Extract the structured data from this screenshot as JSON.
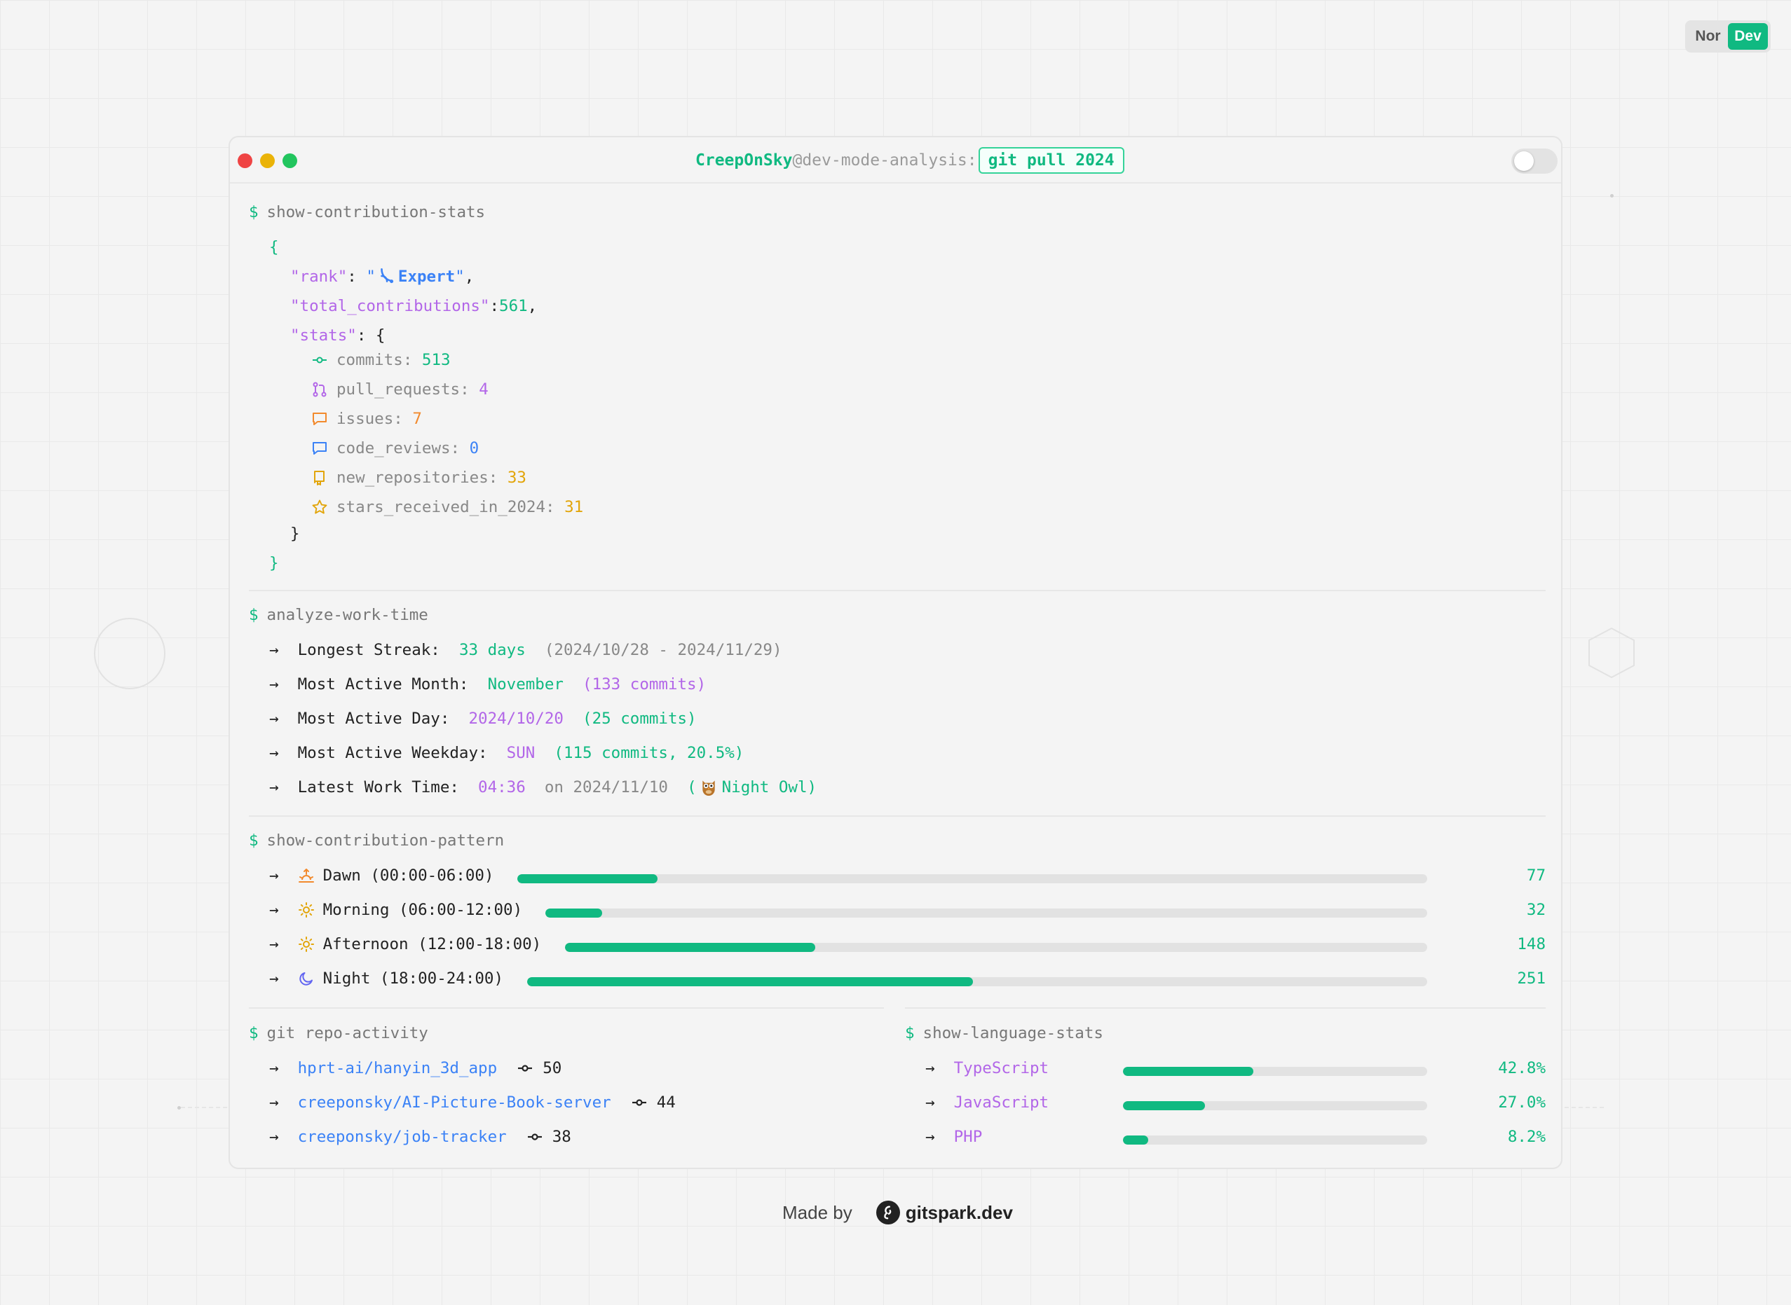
{
  "mode_toggle": {
    "options": [
      "Nor",
      "Dev"
    ],
    "active": "Dev"
  },
  "titlebar": {
    "user": "CreepOnSky",
    "host": "@dev-mode-analysis:",
    "branch": "git pull 2024"
  },
  "contribution_stats": {
    "command": "show-contribution-stats",
    "open_brace": "{",
    "close_brace": "}",
    "rank_key": "\"rank\"",
    "rank_value": "Expert",
    "total_key": "\"total_contributions\"",
    "total_value": "561",
    "stats_key": "\"stats\"",
    "stats": [
      {
        "key": "commits:",
        "value": "513",
        "icon": "commit-icon"
      },
      {
        "key": "pull_requests:",
        "value": "4",
        "icon": "pull-request-icon"
      },
      {
        "key": "issues:",
        "value": "7",
        "icon": "issue-icon"
      },
      {
        "key": "code_reviews:",
        "value": "0",
        "icon": "review-icon"
      },
      {
        "key": "new_repositories:",
        "value": "33",
        "icon": "repository-icon"
      },
      {
        "key": "stars_received_in_2024:",
        "value": "31",
        "icon": "star-icon"
      }
    ]
  },
  "work_time": {
    "command": "analyze-work-time",
    "arrow": "→",
    "longest_streak": {
      "label": "Longest Streak:",
      "value": "33 days",
      "range": "(2024/10/28 - 2024/11/29)"
    },
    "active_month": {
      "label": "Most Active Month:",
      "value": "November",
      "detail": "(133 commits)"
    },
    "active_day": {
      "label": "Most Active Day:",
      "value": "2024/10/20",
      "detail": "(25 commits)"
    },
    "active_weekday": {
      "label": "Most Active Weekday:",
      "value": "SUN",
      "detail": "(115 commits, 20.5%)"
    },
    "latest_time": {
      "label": "Latest Work Time:",
      "value": "04:36",
      "date": "on 2024/11/10",
      "open": "(",
      "badge": "Night Owl)"
    }
  },
  "pattern": {
    "command": "show-contribution-pattern",
    "rows": [
      {
        "label": "Dawn (00:00-06:00)",
        "value": "77",
        "fraction": 0.154,
        "icon": "sunrise-icon"
      },
      {
        "label": "Morning (06:00-12:00)",
        "value": "32",
        "fraction": 0.064,
        "icon": "sun-icon"
      },
      {
        "label": "Afternoon (12:00-18:00)",
        "value": "148",
        "fraction": 0.29,
        "icon": "sun-icon"
      },
      {
        "label": "Night (18:00-24:00)",
        "value": "251",
        "fraction": 0.495,
        "icon": "moon-icon"
      }
    ]
  },
  "repos": {
    "command": "git repo-activity",
    "items": [
      {
        "name": "hprt-ai/hanyin_3d_app",
        "commits": "50"
      },
      {
        "name": "creeponsky/AI-Picture-Book-server",
        "commits": "44"
      },
      {
        "name": "creeponsky/job-tracker",
        "commits": "38"
      }
    ]
  },
  "languages": {
    "command": "show-language-stats",
    "items": [
      {
        "name": "TypeScript",
        "percent": "42.8%",
        "fraction": 0.428
      },
      {
        "name": "JavaScript",
        "percent": "27.0%",
        "fraction": 0.27
      },
      {
        "name": "PHP",
        "percent": "8.2%",
        "fraction": 0.082
      }
    ]
  },
  "footer": {
    "made_by": "Made by",
    "brand": "gitspark.dev"
  },
  "colors": {
    "accent": "#10b981",
    "purple": "#b266e8",
    "blue": "#3b82f6",
    "orange": "#f28a2d",
    "yellow": "#e2a50a"
  }
}
